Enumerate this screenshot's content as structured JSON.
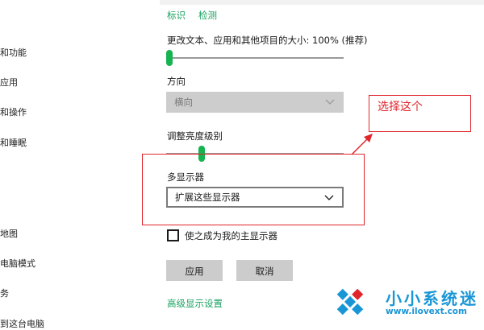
{
  "sidebar": {
    "items": [
      "和功能",
      "应用",
      "和操作",
      "和睡眠",
      "地图",
      "电脑模式",
      "务",
      "到这台电脑"
    ]
  },
  "display": {
    "links": {
      "identify": "标识",
      "detect": "检测"
    },
    "scale_label": "更改文本、应用和其他项目的大小: 100% (推荐)",
    "scale_value_percent": 100,
    "orientation_label": "方向",
    "orientation_value": "横向",
    "brightness_label": "调整亮度级别",
    "brightness_fraction": 0.2,
    "multi_display_label": "多显示器",
    "multi_display_value": "扩展这些显示器",
    "main_display_checkbox": {
      "label": "使之成为我的主显示器",
      "checked": false
    },
    "apply_label": "应用",
    "cancel_label": "取消",
    "advanced_link": "高级显示设置"
  },
  "annotation": {
    "note": "选择这个",
    "color": "#e0252b"
  },
  "watermark": {
    "title": "小小系统迷",
    "url": "www.ilovext.com",
    "color": "#1996d6"
  },
  "colors": {
    "accent": "#16b350",
    "link": "#1aa260"
  }
}
